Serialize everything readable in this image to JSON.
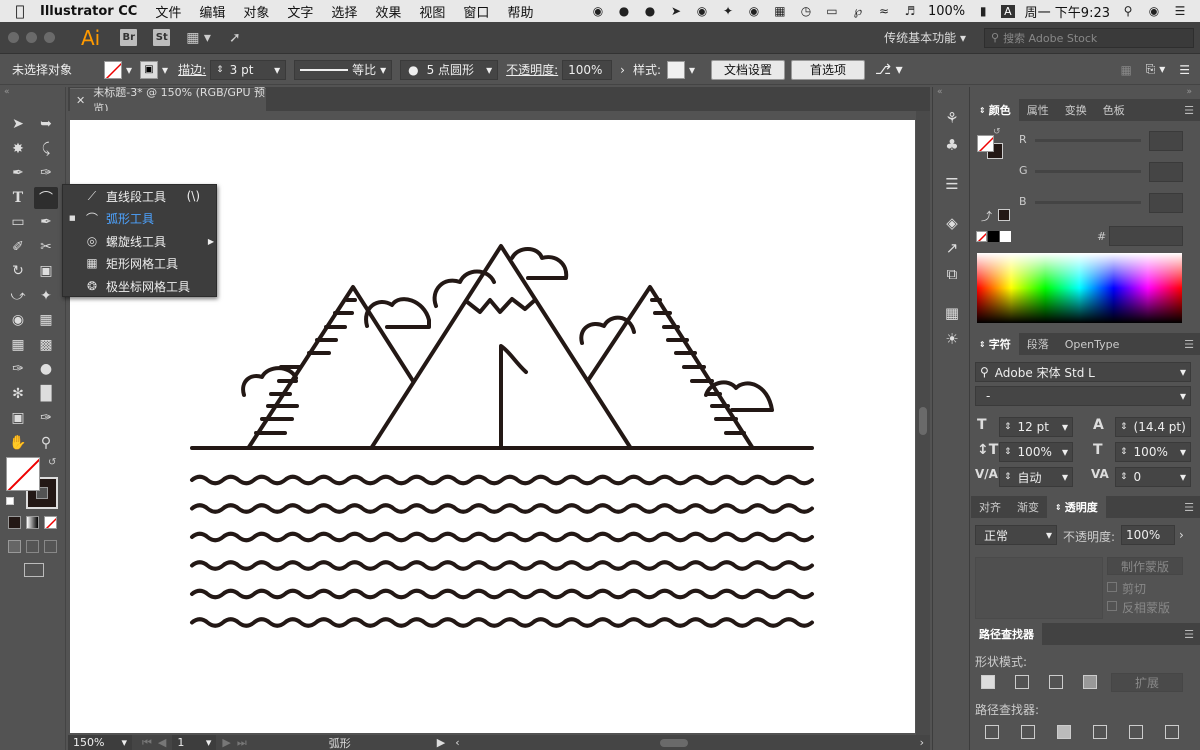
{
  "menubar": {
    "app": "Illustrator CC",
    "items": [
      "文件",
      "编辑",
      "对象",
      "文字",
      "选择",
      "效果",
      "视图",
      "窗口",
      "帮助"
    ],
    "battery": "100%",
    "input_method": "A",
    "clock": "周一 下午9:23"
  },
  "appbar": {
    "logo": "Ai",
    "br": "Br",
    "st": "St",
    "workspace": "传统基本功能",
    "stock_placeholder": "搜索 Adobe Stock"
  },
  "control": {
    "selection": "未选择对象",
    "stroke_label": "描边:",
    "stroke_value": "3 pt",
    "profile": "等比",
    "brush": "5 点圆形",
    "opacity_label": "不透明度:",
    "opacity_value": "100%",
    "style_label": "样式:",
    "doc_setup": "文档设置",
    "preferences": "首选项"
  },
  "document": {
    "tab": "未标题-3* @ 150% (RGB/GPU 预览)"
  },
  "flyout": {
    "items": [
      {
        "label": "直线段工具",
        "shortcut": "(\\)"
      },
      {
        "label": "弧形工具",
        "shortcut": ""
      },
      {
        "label": "螺旋线工具",
        "shortcut": ""
      },
      {
        "label": "矩形网格工具",
        "shortcut": ""
      },
      {
        "label": "极坐标网格工具",
        "shortcut": ""
      }
    ]
  },
  "status": {
    "zoom": "150%",
    "artboard": "1",
    "tool": "弧形"
  },
  "color_panel": {
    "tabs": [
      "颜色",
      "属性",
      "变换",
      "色板"
    ],
    "r": "R",
    "g": "G",
    "b": "B",
    "hash": "#"
  },
  "char_panel": {
    "tabs": [
      "字符",
      "段落",
      "OpenType"
    ],
    "font": "Adobe 宋体 Std L",
    "style": "-",
    "size": "12 pt",
    "leading": "(14.4 pt)",
    "vscale": "100%",
    "hscale": "100%",
    "kerning": "自动",
    "tracking": "0"
  },
  "transparency_panel": {
    "tabs": [
      "对齐",
      "渐变",
      "透明度"
    ],
    "mode": "正常",
    "opacity_label": "不透明度:",
    "opacity": "100%",
    "make_mask": "制作蒙版",
    "clip": "剪切",
    "invert": "反相蒙版"
  },
  "pathfinder": {
    "title": "路径查找器",
    "shape_modes": "形状模式:",
    "expand": "扩展",
    "finders": "路径查找器:"
  },
  "colors": {
    "artwork": "#231815",
    "selected": "#4da3ff"
  }
}
